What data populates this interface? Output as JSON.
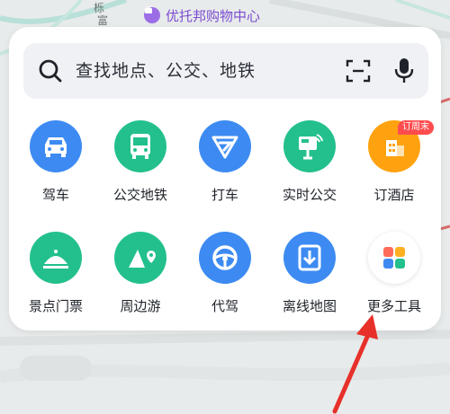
{
  "map": {
    "place_name": "优托邦购物中心",
    "top_labels": [
      "栎",
      "富"
    ]
  },
  "search": {
    "placeholder": "查找地点、公交、地铁"
  },
  "tools": [
    {
      "label": "驾车",
      "icon": "car-icon",
      "color": "#3d8bf2"
    },
    {
      "label": "公交地铁",
      "icon": "bus-icon",
      "color": "#23c08d"
    },
    {
      "label": "打车",
      "icon": "taxi-icon",
      "color": "#3d8bf2"
    },
    {
      "label": "实时公交",
      "icon": "realtime-bus-icon",
      "color": "#23c08d"
    },
    {
      "label": "订酒店",
      "icon": "hotel-icon",
      "color": "#ffa20f"
    },
    {
      "label": "景点门票",
      "icon": "scenic-ticket-icon",
      "color": "#23c08d"
    },
    {
      "label": "周边游",
      "icon": "nearby-trip-icon",
      "color": "#23c08d"
    },
    {
      "label": "代驾",
      "icon": "steering-wheel-icon",
      "color": "#3d8bf2"
    },
    {
      "label": "离线地图",
      "icon": "offline-map-icon",
      "color": "#3d8bf2"
    },
    {
      "label": "更多工具",
      "icon": "more-tools-icon",
      "color": "#ffffff"
    }
  ],
  "hotel_badge": "订周末"
}
